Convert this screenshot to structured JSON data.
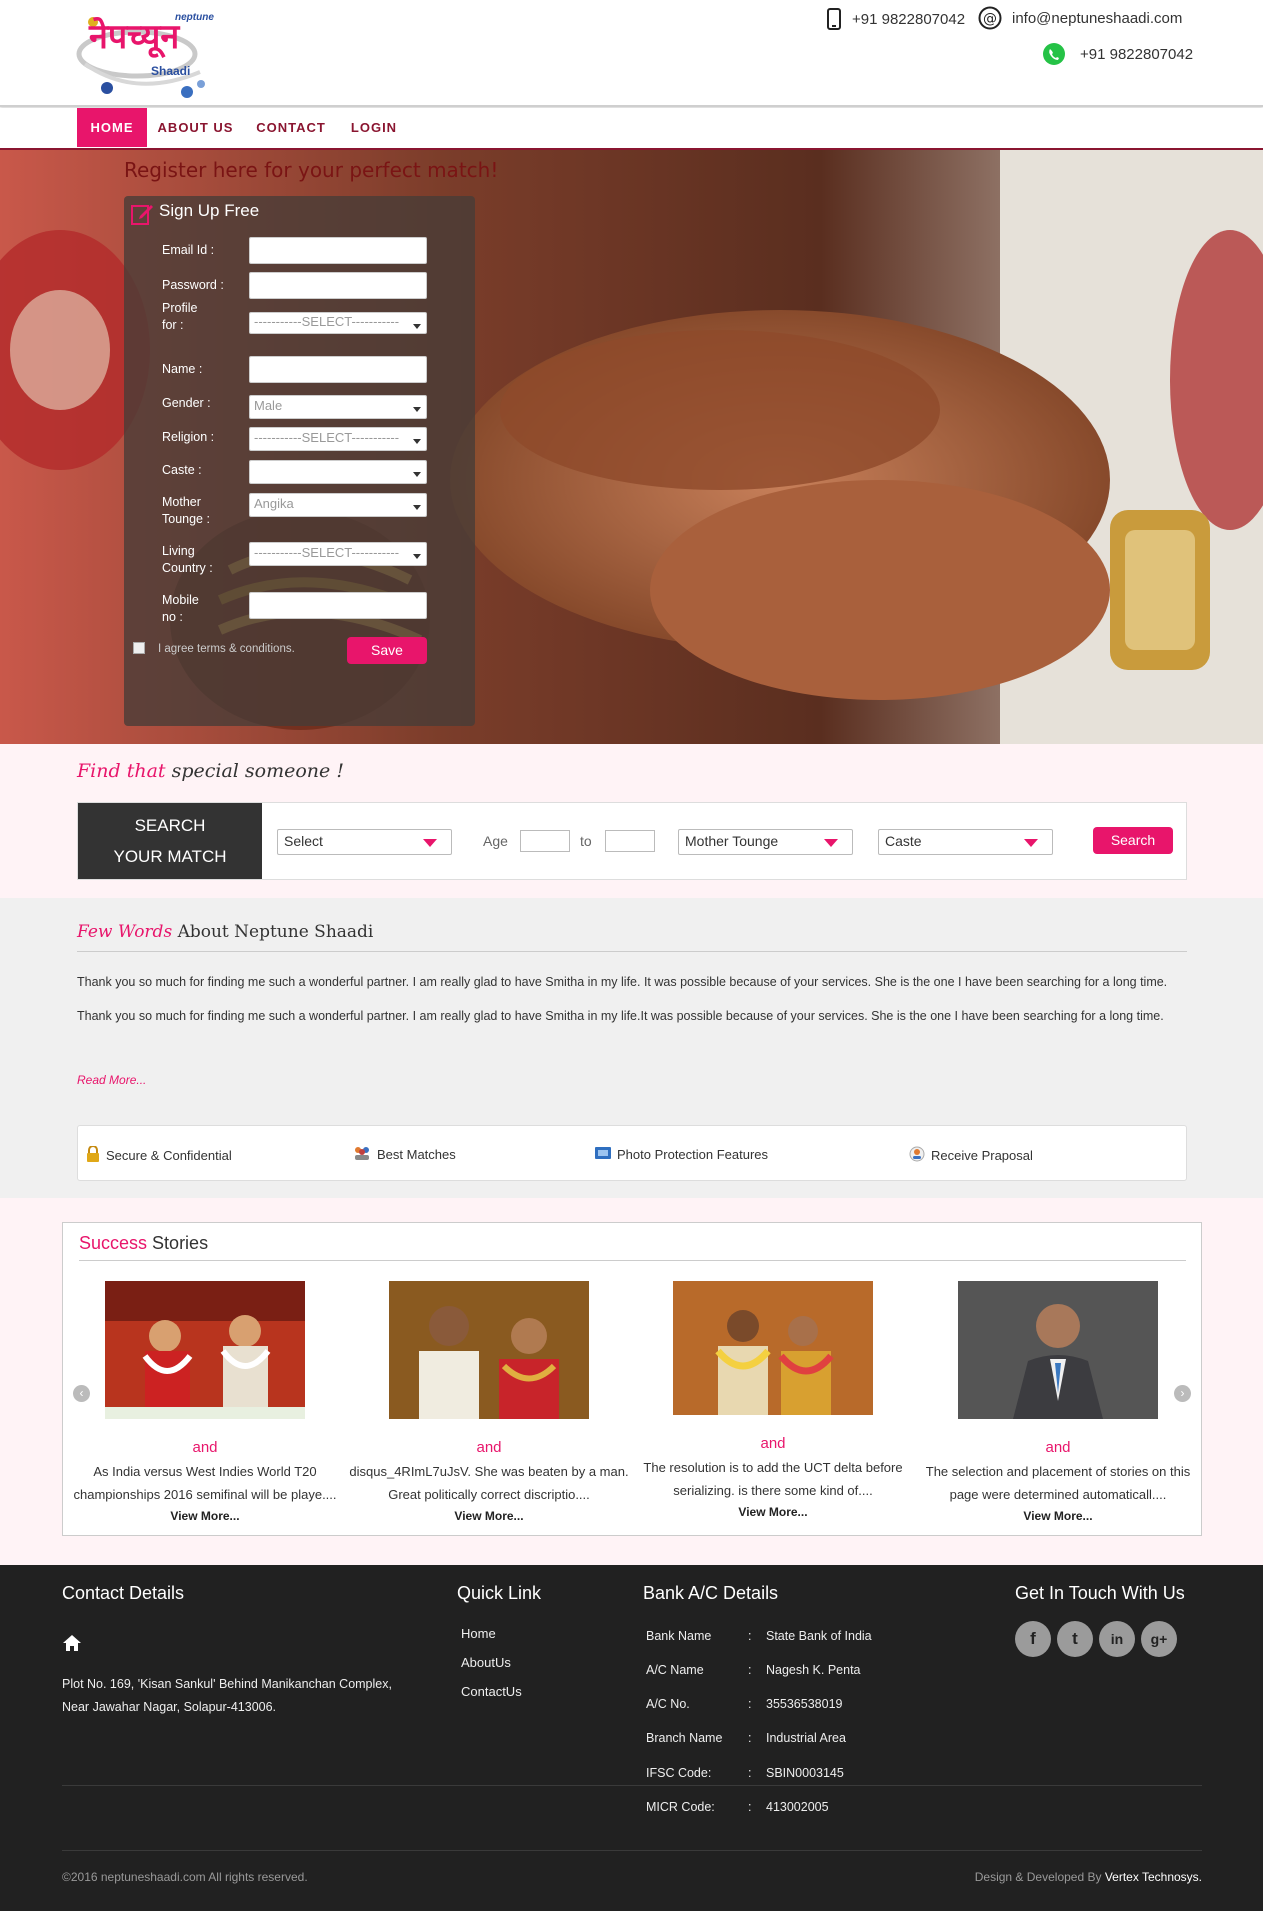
{
  "header": {
    "logo_text": "नेपच्यून",
    "logo_brand": "neptune",
    "logo_sub": "Shaadi",
    "phone": "+91 9822807042",
    "email": "info@neptuneshaadi.com",
    "whatsapp": "+91 9822807042"
  },
  "nav": {
    "items": [
      {
        "label": "HOME"
      },
      {
        "label": "ABOUT US"
      },
      {
        "label": "CONTACT"
      },
      {
        "label": "LOGIN"
      }
    ]
  },
  "hero": {
    "title": "Register here for your perfect match!"
  },
  "signup": {
    "heading": "Sign Up Free",
    "fields": {
      "email": {
        "label": "Email Id  :",
        "value": ""
      },
      "password": {
        "label": "Password  :",
        "value": ""
      },
      "profile_for": {
        "label_1": "Profile",
        "label_2": "for  :",
        "value": "-----------SELECT-----------"
      },
      "name": {
        "label": "Name  :",
        "value": ""
      },
      "gender": {
        "label": "Gender  :",
        "value": "Male"
      },
      "religion": {
        "label": "Religion  :",
        "value": "-----------SELECT-----------"
      },
      "caste": {
        "label": "Caste  :",
        "value": ""
      },
      "mother_tongue": {
        "label_1": "Mother",
        "label_2": "Tounge  :",
        "value": "Angika"
      },
      "living_country": {
        "label_1": "Living",
        "label_2": "Country  :",
        "value": "-----------SELECT-----------"
      },
      "mobile": {
        "label_1": "Mobile",
        "label_2": "no  :",
        "value": ""
      }
    },
    "terms_label": "I agree terms & conditions.",
    "save_label": "Save"
  },
  "search": {
    "heading_pink": "Find that",
    "heading_rest": "special someone !",
    "box_title_1": "SEARCH",
    "box_title_2": "YOUR MATCH",
    "select_value": "Select",
    "age_label": "Age",
    "to_label": "to",
    "mother_tongue_value": "Mother Tounge",
    "caste_value": "Caste",
    "search_button": "Search"
  },
  "about": {
    "heading_pink": "Few Words",
    "heading_rest": "About Neptune Shaadi",
    "paragraph": "Thank you so much for finding me such a wonderful partner. I am really glad to have Smitha in my life. It was possible because of your services. She is the one I have been searching for a long time. Thank you so much for finding me such a wonderful partner. I am really glad to have Smitha in my life.It was possible because of your services. She is the one I have been searching for a long time.",
    "read_more": "Read More..."
  },
  "features": [
    {
      "label": "Secure & Confidential",
      "icon": "lock-icon"
    },
    {
      "label": "Best Matches",
      "icon": "users-icon"
    },
    {
      "label": "Photo Protection Features",
      "icon": "photo-icon"
    },
    {
      "label": "Receive Praposal",
      "icon": "user-icon"
    }
  ],
  "stories": {
    "heading_pink": "Success",
    "heading_rest": "Stories",
    "items": [
      {
        "and": "and",
        "text": "As India versus West Indies World T20 championships 2016 semifinal will be playe....",
        "more": "View More..."
      },
      {
        "and": "and",
        "text": "disqus_4RImL7uJsV. She was beaten by a man. Great politically correct discriptio....",
        "more": "View More..."
      },
      {
        "and": "and",
        "text": "The resolution is to add the UCT delta before serializing. is there some kind of....",
        "more": "View More..."
      },
      {
        "and": "and",
        "text": "The selection and placement of stories on this page were determined automaticall....",
        "more": "View More..."
      }
    ]
  },
  "footer": {
    "contact_heading": "Contact Details",
    "address_1": "Plot No. 169, 'Kisan Sankul' Behind Manikanchan Complex,",
    "address_2": "Near Jawahar Nagar, Solapur-413006.",
    "quick_heading": "Quick Link",
    "quick_links": [
      {
        "label": "Home"
      },
      {
        "label": "AboutUs"
      },
      {
        "label": "ContactUs"
      }
    ],
    "bank_heading": "Bank A/C Details",
    "bank_rows": [
      {
        "key": "Bank Name",
        "sep": ":",
        "value": "State Bank of India"
      },
      {
        "key": "A/C Name",
        "sep": ":",
        "value": "Nagesh K. Penta"
      },
      {
        "key": "A/C No.",
        "sep": ":",
        "value": "35536538019"
      },
      {
        "key": "Branch Name",
        "sep": ":",
        "value": "Industrial Area"
      },
      {
        "key": "IFSC Code:",
        "sep": ":",
        "value": "SBIN0003145"
      },
      {
        "key": "MICR Code:",
        "sep": ":",
        "value": "413002005"
      }
    ],
    "touch_heading": "Get In Touch With Us",
    "social": [
      {
        "icon": "facebook-icon",
        "glyph": "f"
      },
      {
        "icon": "twitter-icon",
        "glyph": "t"
      },
      {
        "icon": "linkedin-icon",
        "glyph": "in"
      },
      {
        "icon": "googleplus-icon",
        "glyph": "g+"
      }
    ],
    "copyright": "©2016 neptuneshaadi.com All rights reserved.",
    "credit_prefix": "Design & Developed By",
    "credit_name": "Vertex Technosys."
  },
  "colors": {
    "accent": "#e8156b",
    "maroon": "#8a1530",
    "footer_bg": "#212121"
  }
}
